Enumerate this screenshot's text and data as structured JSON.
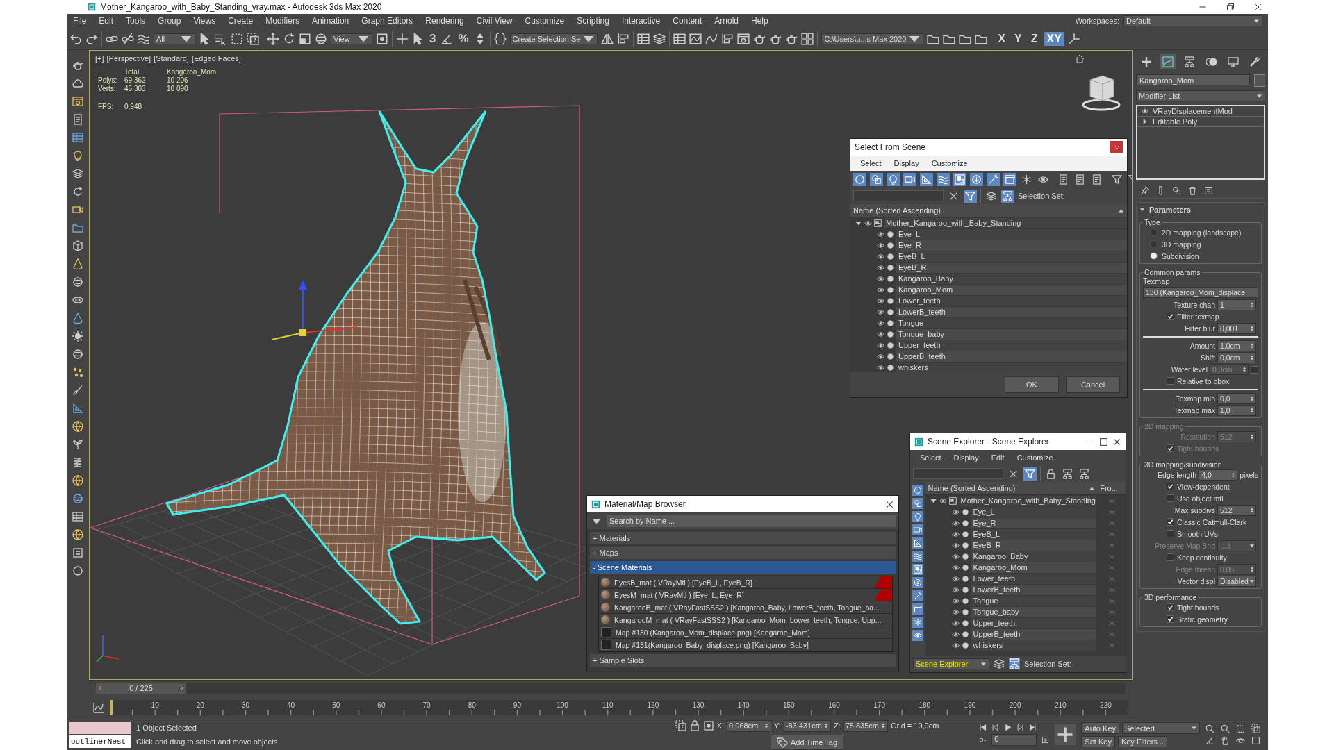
{
  "window": {
    "title": "Mother_Kangaroo_with_Baby_Standing_vray.max - Autodesk 3ds Max 2020"
  },
  "menu": [
    "File",
    "Edit",
    "Tools",
    "Group",
    "Views",
    "Create",
    "Modifiers",
    "Animation",
    "Graph Editors",
    "Rendering",
    "Civil View",
    "Customize",
    "Scripting",
    "Interactive",
    "Content",
    "Arnold",
    "Help"
  ],
  "workspace": {
    "label": "Workspaces:",
    "value": "Default"
  },
  "toolbar": {
    "selection_filter": "All",
    "reference_coordinate": "View",
    "snap_toggle": "3",
    "percent_snap": "%",
    "named_selection": "Create Selection Se",
    "project_folder": "C:\\Users\\u...s Max 2020",
    "axis_constraints": [
      {
        "label": "X",
        "selected": false
      },
      {
        "label": "Y",
        "selected": false
      },
      {
        "label": "Z",
        "selected": false
      },
      {
        "label": "XY",
        "selected": true
      }
    ]
  },
  "viewport": {
    "labels": [
      "[+]",
      "[Perspective]",
      "[Standard]",
      "[Edged Faces]"
    ],
    "stats": {
      "columns": [
        "Total",
        "Kangaroo_Mom"
      ],
      "rows": [
        {
          "label": "Polys:",
          "values": [
            "69 362",
            "10 206"
          ]
        },
        {
          "label": "Verts:",
          "values": [
            "45 303",
            "10 090"
          ]
        }
      ],
      "fps_label": "FPS:",
      "fps": "0,948"
    }
  },
  "select_from_scene": {
    "title": "Select From Scene",
    "menu": [
      "Select",
      "Display",
      "Customize"
    ],
    "filters": [
      {
        "on": true
      },
      {
        "on": true
      },
      {
        "on": true
      },
      {
        "on": true
      },
      {
        "on": true
      },
      {
        "on": true
      },
      {
        "on": true
      },
      {
        "on": true
      },
      {
        "on": true
      },
      {
        "on": true
      },
      {
        "on": false
      },
      {
        "on": false
      }
    ],
    "find_filter_on": true,
    "hierarchy_on": true,
    "selection_set_label": "Selection Set:",
    "column": "Name (Sorted Ascending)",
    "tree": {
      "label": "Mother_Kangaroo_with_Baby_Standing",
      "expanded": true,
      "children": [
        {
          "label": "Eye_L"
        },
        {
          "label": "Eye_R"
        },
        {
          "label": "EyeB_L"
        },
        {
          "label": "EyeB_R"
        },
        {
          "label": "Kangaroo_Baby"
        },
        {
          "label": "Kangaroo_Mom"
        },
        {
          "label": "Lower_teeth"
        },
        {
          "label": "LowerB_teeth"
        },
        {
          "label": "Tongue"
        },
        {
          "label": "Tongue_baby"
        },
        {
          "label": "Upper_teeth"
        },
        {
          "label": "UpperB_teeth"
        },
        {
          "label": "whiskers"
        }
      ]
    },
    "buttons": [
      "OK",
      "Cancel"
    ]
  },
  "material_browser": {
    "title": "Material/Map Browser",
    "placeholder": "Search by Name ...",
    "sections": [
      {
        "sign": "+",
        "label": "Materials",
        "expanded": false
      },
      {
        "sign": "+",
        "label": "Maps",
        "expanded": false
      },
      {
        "sign": "-",
        "label": "Scene Materials",
        "expanded": true,
        "items": [
          {
            "kind": "material",
            "label": "EyesB_mat ( VRayMtl ) [EyeB_L, EyeB_R]",
            "flagged": true
          },
          {
            "kind": "material",
            "label": "EyesM_mat ( VRayMtl ) [Eye_L, Eye_R]",
            "flagged": true
          },
          {
            "kind": "material",
            "label": "KangarooB_mat ( VRayFastSSS2 ) [Kangaroo_Baby, LowerB_teeth, Tongue_ba...",
            "flagged": false
          },
          {
            "kind": "material",
            "label": "KangarooM_mat ( VRayFastSSS2 ) [Kangaroo_Mom, Lower_teeth, Tongue, Upp...",
            "flagged": false
          },
          {
            "kind": "map",
            "label": "Map #130 (Kangaroo_Mom_displace.png) [Kangaroo_Mom]",
            "flagged": false
          },
          {
            "kind": "map",
            "label": "Map #131(Kangaroo_Baby_displace.png) [Kangaroo_Baby]",
            "flagged": false
          }
        ]
      },
      {
        "sign": "+",
        "label": "Sample Slots",
        "expanded": false
      }
    ]
  },
  "scene_explorer": {
    "title": "Scene Explorer - Scene Explorer",
    "menu": [
      "Select",
      "Display",
      "Edit",
      "Customize"
    ],
    "filters": [
      {
        "on": true
      },
      {
        "on": true
      },
      {
        "on": true
      },
      {
        "on": true
      },
      {
        "on": true
      },
      {
        "on": true
      },
      {
        "on": true
      },
      {
        "on": true
      },
      {
        "on": true
      },
      {
        "on": true
      },
      {
        "on": true
      },
      {
        "on": true
      }
    ],
    "find_filter_on": true,
    "hierarchy_on": true,
    "columns": [
      "Name (Sorted Ascending)",
      "Fro..."
    ],
    "tree": {
      "label": "Mother_Kangaroo_with_Baby_Standing",
      "expanded": true,
      "children": [
        {
          "label": "Eye_L"
        },
        {
          "label": "Eye_R"
        },
        {
          "label": "EyeB_L"
        },
        {
          "label": "EyeB_R"
        },
        {
          "label": "Kangaroo_Baby"
        },
        {
          "label": "Kangaroo_Mom"
        },
        {
          "label": "Lower_teeth"
        },
        {
          "label": "LowerB_teeth"
        },
        {
          "label": "Tongue"
        },
        {
          "label": "Tongue_baby"
        },
        {
          "label": "Upper_teeth"
        },
        {
          "label": "UpperB_teeth"
        },
        {
          "label": "whiskers"
        }
      ]
    },
    "explorer_name": "Scene Explorer",
    "selection_set_label": "Selection Set:"
  },
  "time_slider": {
    "label": "0 / 225",
    "level": 0
  },
  "track_bar": {
    "labels": [
      "10",
      "20",
      "30",
      "40",
      "50",
      "60",
      "70",
      "80",
      "90",
      "100",
      "110",
      "120",
      "130",
      "140",
      "150",
      "160",
      "170",
      "180",
      "190",
      "200",
      "210",
      "220"
    ]
  },
  "command_panel": {
    "tabs": [
      {
        "selected": false
      },
      {
        "selected": true
      },
      {
        "selected": false
      },
      {
        "selected": false
      },
      {
        "selected": false
      },
      {
        "selected": false
      }
    ],
    "object_name": "Kangaroo_Mom",
    "modifier_list": "Modifier List",
    "stack": [
      {
        "kind": "modifier",
        "label": "VRayDisplacementMod"
      },
      {
        "kind": "object",
        "label": "Editable Poly"
      }
    ],
    "rollout": {
      "title": "Parameters",
      "expanded": true
    },
    "groups": [
      {
        "title": "Type",
        "disabled": false,
        "rows": [
          {
            "kind": "radio",
            "label": "2D mapping (landscape)",
            "selected": false
          },
          {
            "kind": "radio",
            "label": "3D mapping",
            "selected": false
          },
          {
            "kind": "radio",
            "label": "Subdivision",
            "selected": true
          }
        ]
      },
      {
        "title": "Common params",
        "disabled": false,
        "rows": [
          {
            "kind": "label",
            "label": "Texmap"
          },
          {
            "kind": "button",
            "value": "130 (Kangaroo_Mom_displace"
          },
          {
            "kind": "spinner",
            "label": "Texture chan",
            "value": "1",
            "disabled": false
          },
          {
            "kind": "checkbox",
            "label": "Filter texmap",
            "checked": true,
            "disabled": false
          },
          {
            "kind": "spinner",
            "label": "Filter blur",
            "value": "0,001",
            "disabled": false
          },
          {
            "kind": "rule"
          },
          {
            "kind": "spinner",
            "label": "Amount",
            "value": "1,0cm",
            "disabled": false
          },
          {
            "kind": "spinner",
            "label": "Shift",
            "value": "0,0cm",
            "disabled": false
          },
          {
            "kind": "check_spinner",
            "label": "Water level",
            "checked": false,
            "value": "0,0cm",
            "disabled": true
          },
          {
            "kind": "checkbox",
            "label": "Relative to bbox",
            "checked": false,
            "disabled": false
          },
          {
            "kind": "rule"
          },
          {
            "kind": "spinner",
            "label": "Texmap min",
            "value": "0,0",
            "disabled": false
          },
          {
            "kind": "spinner",
            "label": "Texmap max",
            "value": "1,0",
            "disabled": false
          }
        ]
      },
      {
        "title": "2D mapping",
        "disabled": true,
        "rows": [
          {
            "kind": "spinner",
            "label": "Resolution",
            "value": "512",
            "disabled": true
          },
          {
            "kind": "checkbox",
            "label": "Tight bounds",
            "checked": true,
            "disabled": true
          }
        ]
      },
      {
        "title": "3D mapping/subdivision",
        "disabled": false,
        "rows": [
          {
            "kind": "spinner",
            "label": "Edge length",
            "value": "4,0",
            "suffix": "pixels",
            "disabled": false
          },
          {
            "kind": "checkbox",
            "label": "View-dependent",
            "checked": true,
            "disabled": false
          },
          {
            "kind": "checkbox",
            "label": "Use object mtl",
            "checked": false,
            "disabled": false
          },
          {
            "kind": "spinner",
            "label": "Max subdivs",
            "value": "512",
            "disabled": false
          },
          {
            "kind": "checkbox",
            "label": "Classic Catmull-Clark",
            "checked": true,
            "disabled": false
          },
          {
            "kind": "checkbox",
            "label": "Smooth UVs",
            "checked": false,
            "disabled": false
          },
          {
            "kind": "dropdown",
            "label": "Preserve Map Bnd",
            "value": "I...I",
            "disabled": true
          },
          {
            "kind": "checkbox",
            "label": "Keep continuity",
            "checked": false,
            "disabled": false
          },
          {
            "kind": "spinner",
            "label": "Edge thresh",
            "value": "0,05",
            "disabled": true
          },
          {
            "kind": "dropdown",
            "label": "Vector displ",
            "value": "Disabled",
            "disabled": false
          }
        ]
      },
      {
        "title": "3D performance",
        "disabled": false,
        "rows": [
          {
            "kind": "checkbox",
            "label": "Tight bounds",
            "checked": true,
            "disabled": false
          },
          {
            "kind": "checkbox",
            "label": "Static geometry",
            "checked": true,
            "disabled": false
          }
        ]
      }
    ]
  },
  "status_bar": {
    "listener": "outlinerNest",
    "selected_count": "1 Object Selected",
    "prompt": "Click and drag to select and move objects",
    "coords": [
      {
        "label": "X:",
        "value": "0,068cm"
      },
      {
        "label": "Y:",
        "value": "-83,431cm"
      },
      {
        "label": "Z:",
        "value": "75,835cm"
      }
    ],
    "grid": "Grid = 10,0cm",
    "time_tag": "Add Time Tag",
    "frame": "0",
    "auto_key": "Auto Key",
    "key_mode": "Selected",
    "set_key": "Set Key",
    "key_filters": "Key Filters..."
  }
}
